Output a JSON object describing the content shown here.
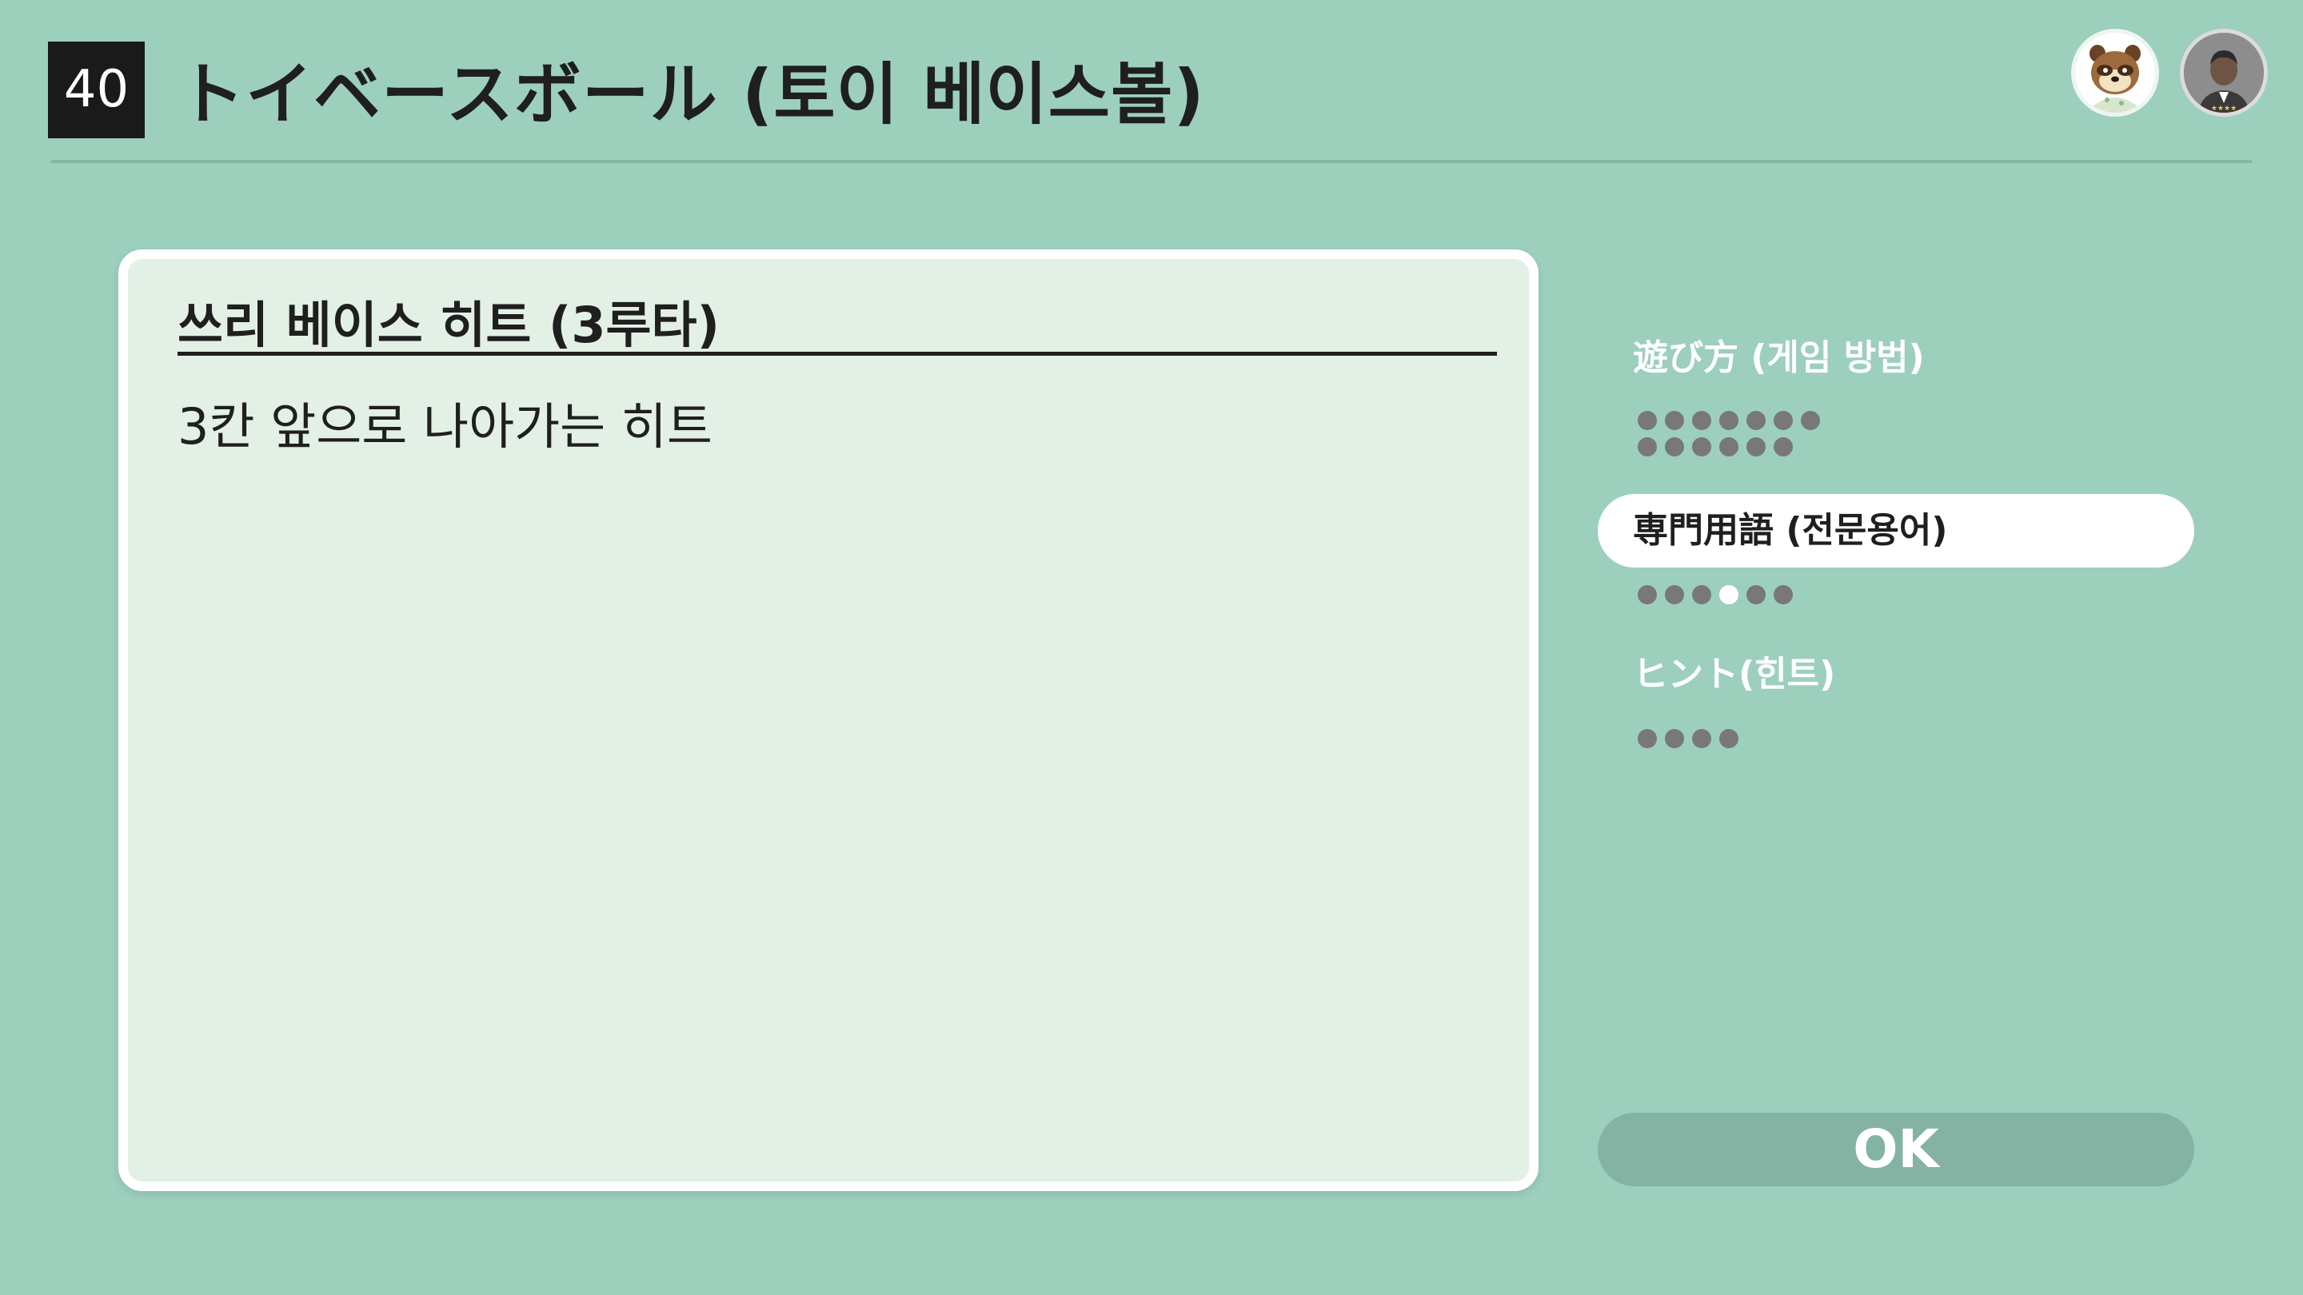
{
  "header": {
    "game_number": "40",
    "title": "トイベースボール (토이 베이스볼)"
  },
  "avatars": [
    {
      "icon": "raccoon-character-icon"
    },
    {
      "icon": "player-profile-icon"
    }
  ],
  "term": {
    "title": "쓰리 베이스 히트 (3루타)",
    "description": "3칸 앞으로 나아가는 히트"
  },
  "menu": [
    {
      "label": "遊び方 (게임 방법)",
      "page_count": 13,
      "current_page": null,
      "active": false
    },
    {
      "label": "専門用語 (전문용어)",
      "page_count": 6,
      "current_page": 4,
      "active": true
    },
    {
      "label": "ヒント(힌트)",
      "page_count": 4,
      "current_page": null,
      "active": false
    }
  ],
  "ok_button": {
    "label": "OK"
  },
  "colors": {
    "background": "#9dcfbd",
    "card": "#e3f0e6",
    "dot": "#787878",
    "ok_button": "#84b3a3"
  }
}
